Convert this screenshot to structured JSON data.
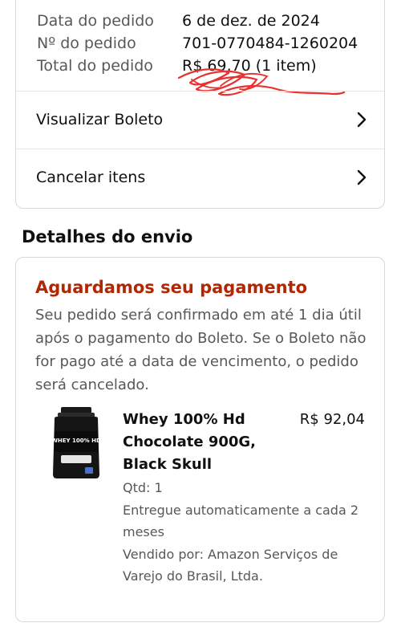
{
  "order": {
    "date_label": "Data do pedido",
    "date_value": "6 de dez. de 2024",
    "number_label": "Nº do pedido",
    "number_value": "701-0770484-1260204",
    "total_label": "Total do pedido",
    "total_value": "R$ 69,70 (1 item)"
  },
  "actions": {
    "view_boleto": "Visualizar Boleto",
    "cancel_items": "Cancelar itens"
  },
  "shipping": {
    "section_title": "Detalhes do envio",
    "status_title": "Aguardamos seu pagamento",
    "status_text": "Seu pedido será confirmado em até 1 dia útil após o pagamento do Boleto. Se o Boleto não for pago até a data de vencimento, o pedido será cancelado.",
    "product": {
      "name": "Whey 100% Hd Chocolate 900G, Black Skull",
      "price": "R$ 92,04",
      "quantity": "Qtd: 1",
      "delivery": "Entregue automaticamente a cada 2 meses",
      "seller": "Vendido por: Amazon Serviços de Varejo do Brasil, Ltda.",
      "image_label": "WHEY 100% HD"
    }
  },
  "colors": {
    "status_red": "#b12704",
    "scribble_red": "#e8322f",
    "border": "#d5d9d9"
  },
  "icons": {
    "chevron": "chevron-right-icon"
  }
}
